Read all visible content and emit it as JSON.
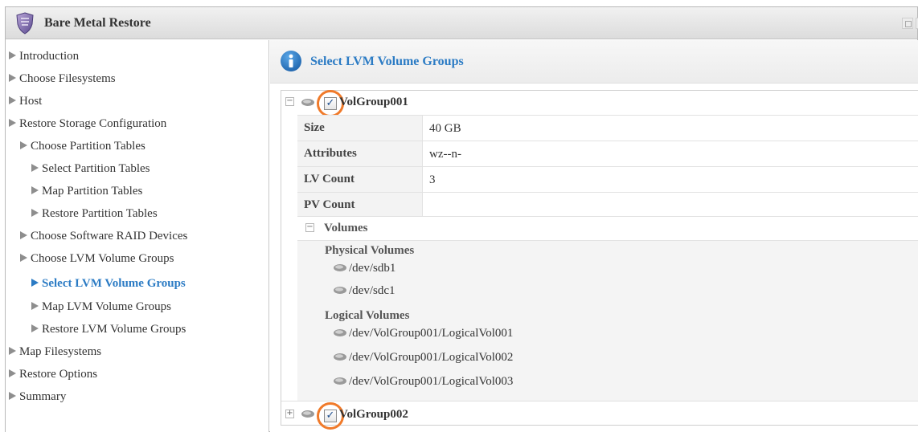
{
  "window": {
    "title": "Bare Metal Restore"
  },
  "sidebar": {
    "items": [
      {
        "label": "Introduction"
      },
      {
        "label": "Choose Filesystems"
      },
      {
        "label": "Host"
      },
      {
        "label": "Restore Storage Configuration"
      },
      {
        "label": "Choose Partition Tables"
      },
      {
        "label": "Select Partition Tables"
      },
      {
        "label": "Map Partition Tables"
      },
      {
        "label": "Restore Partition Tables"
      },
      {
        "label": "Choose Software RAID Devices"
      },
      {
        "label": "Choose LVM Volume Groups"
      },
      {
        "label": "Select LVM Volume Groups",
        "active": true
      },
      {
        "label": "Map LVM Volume Groups"
      },
      {
        "label": "Restore LVM Volume Groups"
      },
      {
        "label": "Map Filesystems"
      },
      {
        "label": "Restore Options"
      },
      {
        "label": "Summary"
      }
    ]
  },
  "main": {
    "title": "Select LVM Volume Groups",
    "volume_groups": [
      {
        "name": "VolGroup001",
        "checked": true,
        "expanded": true,
        "check_mark": "✓",
        "expander": "−",
        "properties": [
          {
            "key": "Size",
            "value": "40 GB"
          },
          {
            "key": "Attributes",
            "value": "wz--n-"
          },
          {
            "key": "LV Count",
            "value": "3"
          },
          {
            "key": "PV Count",
            "value": ""
          }
        ],
        "volumes": {
          "title": "Volumes",
          "expander": "−",
          "physical_label": "Physical Volumes",
          "physical": [
            "/dev/sdb1",
            "/dev/sdc1"
          ],
          "logical_label": "Logical Volumes",
          "logical": [
            "/dev/VolGroup001/LogicalVol001",
            "/dev/VolGroup001/LogicalVol002",
            "/dev/VolGroup001/LogicalVol003"
          ]
        }
      },
      {
        "name": "VolGroup002",
        "checked": true,
        "expanded": false,
        "check_mark": "✓",
        "expander": "+"
      }
    ]
  },
  "colors": {
    "accent": "#2b7bc4",
    "highlight_ring": "#f07a2a"
  }
}
